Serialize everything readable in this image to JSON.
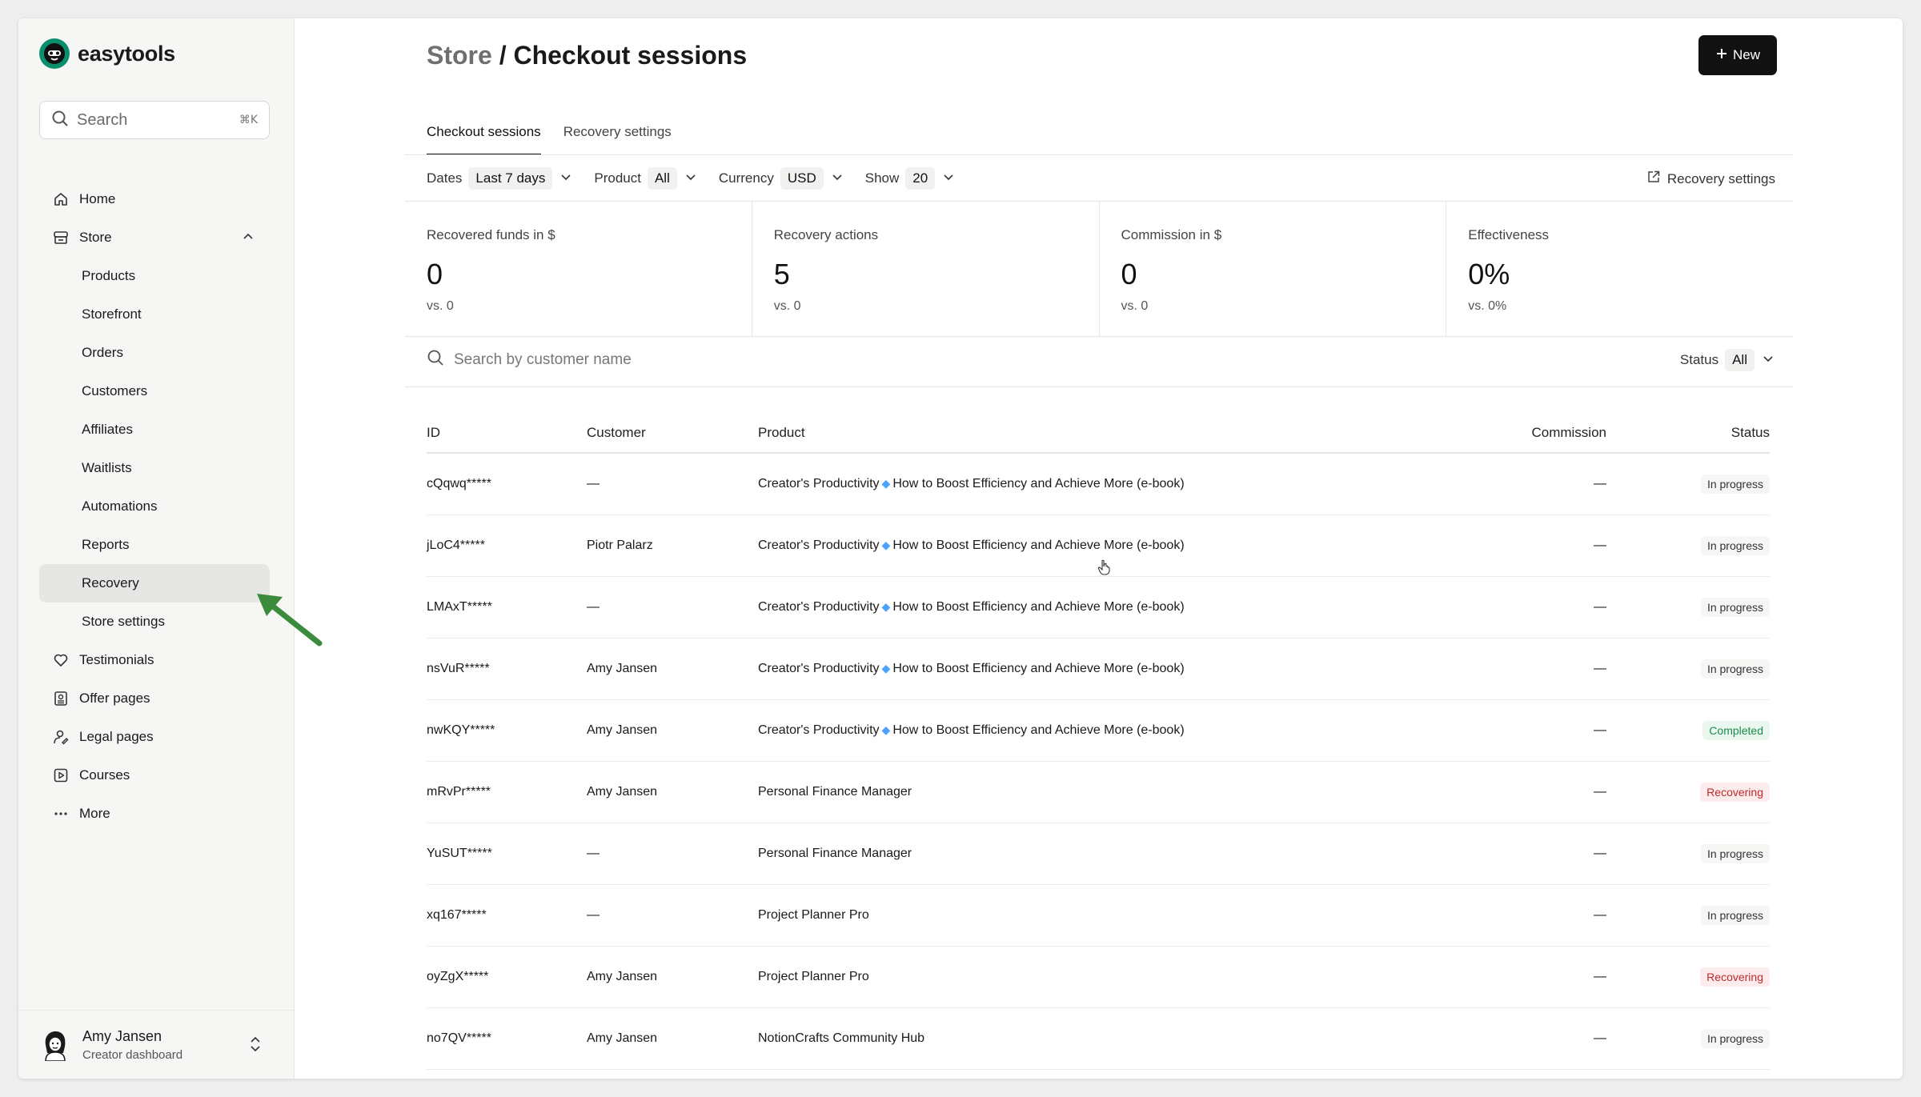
{
  "brand": {
    "name": "easytools",
    "color": "#0a8f6c"
  },
  "search": {
    "placeholder": "Search",
    "shortcut": "⌘K"
  },
  "nav": {
    "items": [
      {
        "label": "Home",
        "icon": "home-icon"
      },
      {
        "label": "Store",
        "icon": "store-icon",
        "expanded": true
      },
      {
        "label": "Products",
        "sub": true
      },
      {
        "label": "Storefront",
        "sub": true
      },
      {
        "label": "Orders",
        "sub": true
      },
      {
        "label": "Customers",
        "sub": true
      },
      {
        "label": "Affiliates",
        "sub": true
      },
      {
        "label": "Waitlists",
        "sub": true
      },
      {
        "label": "Automations",
        "sub": true
      },
      {
        "label": "Reports",
        "sub": true
      },
      {
        "label": "Recovery",
        "sub": true,
        "active": true
      },
      {
        "label": "Store settings",
        "sub": true
      },
      {
        "label": "Testimonials",
        "icon": "heart-icon"
      },
      {
        "label": "Offer pages",
        "icon": "offer-page-icon"
      },
      {
        "label": "Legal pages",
        "icon": "legal-icon"
      },
      {
        "label": "Courses",
        "icon": "play-square-icon"
      },
      {
        "label": "More",
        "icon": "ellipsis-icon"
      }
    ]
  },
  "user": {
    "name": "Amy Jansen",
    "role": "Creator dashboard"
  },
  "header": {
    "breadcrumb": "Store",
    "separator": " / ",
    "title": "Checkout sessions",
    "new_label": "New"
  },
  "tabs": [
    {
      "label": "Checkout sessions",
      "active": true
    },
    {
      "label": "Recovery settings",
      "active": false
    }
  ],
  "filters": {
    "dates": {
      "label": "Dates",
      "value": "Last 7 days"
    },
    "product": {
      "label": "Product",
      "value": "All"
    },
    "currency": {
      "label": "Currency",
      "value": "USD"
    },
    "show": {
      "label": "Show",
      "value": "20"
    },
    "recovery_link": "Recovery settings"
  },
  "stats": [
    {
      "label": "Recovered funds in $",
      "value": "0",
      "vs": "vs. 0"
    },
    {
      "label": "Recovery actions",
      "value": "5",
      "vs": "vs. 0"
    },
    {
      "label": "Commission in $",
      "value": "0",
      "vs": "vs. 0"
    },
    {
      "label": "Effectiveness",
      "value": "0%",
      "vs": "vs. 0%"
    }
  ],
  "customer_search": {
    "placeholder": "Search by customer name"
  },
  "status_filter": {
    "label": "Status",
    "value": "All"
  },
  "table": {
    "columns": [
      "ID",
      "Customer",
      "Product",
      "Commission",
      "Status"
    ],
    "rows": [
      {
        "id": "cQqwq*****",
        "customer": "—",
        "product_a": "Creator's Productivity",
        "product_b": "How to Boost Efficiency and Achieve More (e-book)",
        "commission": "—",
        "status": "In progress",
        "status_type": "inprogress"
      },
      {
        "id": "jLoC4*****",
        "customer": "Piotr Palarz",
        "product_a": "Creator's Productivity",
        "product_b": "How to Boost Efficiency and Achieve More (e-book)",
        "commission": "—",
        "status": "In progress",
        "status_type": "inprogress"
      },
      {
        "id": "LMAxT*****",
        "customer": "—",
        "product_a": "Creator's Productivity",
        "product_b": "How to Boost Efficiency and Achieve More (e-book)",
        "commission": "—",
        "status": "In progress",
        "status_type": "inprogress"
      },
      {
        "id": "nsVuR*****",
        "customer": "Amy Jansen",
        "product_a": "Creator's Productivity",
        "product_b": "How to Boost Efficiency and Achieve More (e-book)",
        "commission": "—",
        "status": "In progress",
        "status_type": "inprogress"
      },
      {
        "id": "nwKQY*****",
        "customer": "Amy Jansen",
        "product_a": "Creator's Productivity",
        "product_b": "How to Boost Efficiency and Achieve More (e-book)",
        "commission": "—",
        "status": "Completed",
        "status_type": "completed"
      },
      {
        "id": "mRvPr*****",
        "customer": "Amy Jansen",
        "product_a": "Personal Finance Manager",
        "product_b": "",
        "commission": "—",
        "status": "Recovering",
        "status_type": "recovering"
      },
      {
        "id": "YuSUT*****",
        "customer": "—",
        "product_a": "Personal Finance Manager",
        "product_b": "",
        "commission": "—",
        "status": "In progress",
        "status_type": "inprogress"
      },
      {
        "id": "xq167*****",
        "customer": "—",
        "product_a": "Project Planner Pro",
        "product_b": "",
        "commission": "—",
        "status": "In progress",
        "status_type": "inprogress"
      },
      {
        "id": "oyZgX*****",
        "customer": "Amy Jansen",
        "product_a": "Project Planner Pro",
        "product_b": "",
        "commission": "—",
        "status": "Recovering",
        "status_type": "recovering"
      },
      {
        "id": "no7QV*****",
        "customer": "Amy Jansen",
        "product_a": "NotionCrafts Community Hub",
        "product_b": "",
        "commission": "—",
        "status": "In progress",
        "status_type": "inprogress"
      }
    ]
  },
  "colors": {
    "arrow": "#3c8a3c",
    "primary_button": "#111111"
  }
}
